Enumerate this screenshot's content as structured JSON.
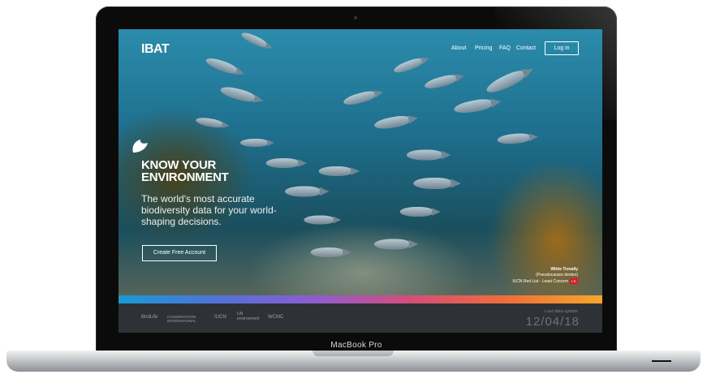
{
  "nav": {
    "logo": "IBAT",
    "links": [
      "About",
      "Pricing",
      "FAQ",
      "Contact"
    ],
    "login": "Log in"
  },
  "hero": {
    "title_line1": "KNOW YOUR",
    "title_line2": "ENVIRONMENT",
    "subtitle": "The world's most accurate biodiversity data for your world-shaping decisions.",
    "cta": "Create Free Account"
  },
  "caption": {
    "species": "White Trevally",
    "latin": "(Pseudocaranx dentex)",
    "status": "IUCN Red List - Least Concern",
    "badge": "LC"
  },
  "footer": {
    "partners": [
      "BirdLife",
      "CONSERVATION INTERNATIONAL",
      "IUCN",
      "UN environment",
      "WCMC"
    ],
    "update_label": "Last data update",
    "update_date": "12/04/18"
  },
  "device": {
    "brand": "MacBook Pro"
  },
  "colors": {
    "badge": "#d71920",
    "footer_bg": "#2e3236",
    "bezel": "#0b0b0b"
  }
}
